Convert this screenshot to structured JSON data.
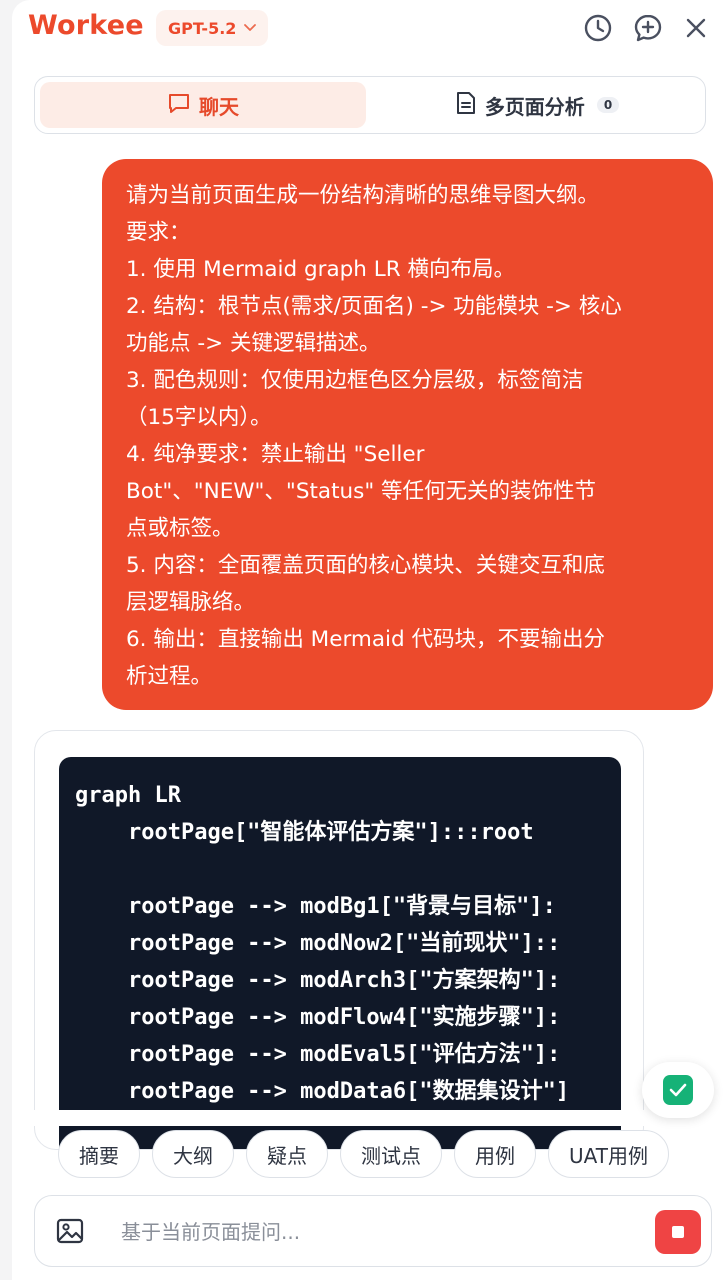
{
  "header": {
    "brand": "Workee",
    "model_label": "GPT-5.2",
    "icons": [
      "clock-icon",
      "new-chat-icon",
      "close-icon"
    ]
  },
  "tabs": [
    {
      "label": "聊天",
      "icon": "chat-icon",
      "active": true
    },
    {
      "label": "多页面分析",
      "icon": "document-icon",
      "active": false,
      "badge": "0"
    }
  ],
  "user_message": {
    "lines": [
      "请为当前页面生成一份结构清晰的思维导图大纲。",
      "要求：",
      "1. 使用 Mermaid graph LR 横向布局。",
      "2. 结构：根节点(需求/页面名) -> 功能模块 -> 核心",
      "功能点 -> 关键逻辑描述。",
      "3. 配色规则：仅使用边框色区分层级，标签简洁",
      "（15字以内）。",
      "4. 纯净要求：禁止输出 \"Seller",
      "Bot\"、\"NEW\"、\"Status\" 等任何无关的装饰性节",
      "点或标签。",
      "5. 内容：全面覆盖页面的核心模块、关键交互和底",
      "层逻辑脉络。",
      "6. 输出：直接输出 Mermaid 代码块，不要输出分",
      "析过程。"
    ]
  },
  "assistant_message": {
    "code_lines": [
      "graph LR",
      "    rootPage[\"智能体评估方案\"]:::root",
      "",
      "    rootPage --> modBg1[\"背景与目标\"]:",
      "    rootPage --> modNow2[\"当前现状\"]::",
      "    rootPage --> modArch3[\"方案架构\"]:",
      "    rootPage --> modFlow4[\"实施步骤\"]:",
      "    rootPage --> modEval5[\"评估方法\"]:",
      "    rootPage --> modData6[\"数据集设计\"]"
    ]
  },
  "quick_actions": [
    "摘要",
    "大纲",
    "疑点",
    "测试点",
    "用例",
    "UAT用例"
  ],
  "composer": {
    "placeholder": "基于当前页面提问...",
    "image_icon": "image-icon",
    "stop_icon": "stop-icon"
  },
  "colors": {
    "accent": "#ec4a2c",
    "accent_soft": "#fdece6",
    "code_bg": "#101828",
    "success": "#16b277",
    "stop": "#ef4444"
  }
}
